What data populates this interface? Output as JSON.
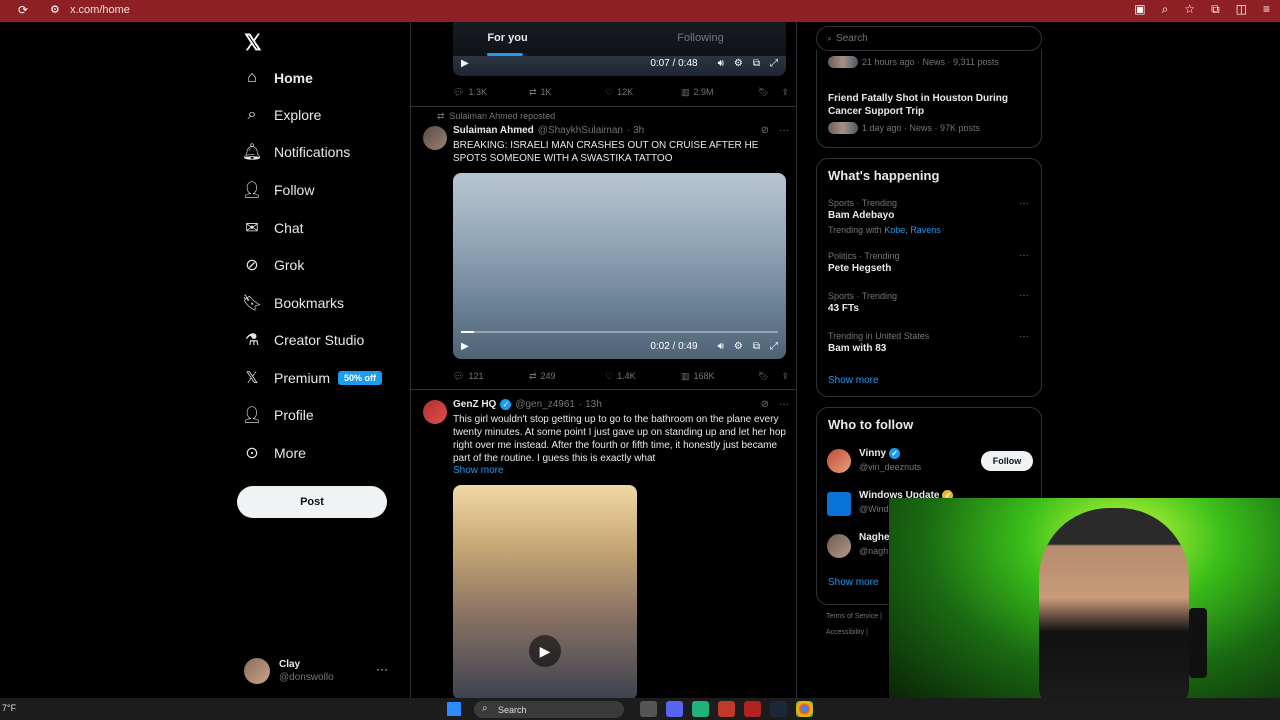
{
  "browser": {
    "url": "x.com/home"
  },
  "nav": {
    "logo": "𝕏",
    "items": [
      {
        "label": "Home",
        "icon": "home-icon"
      },
      {
        "label": "Explore",
        "icon": "search-icon"
      },
      {
        "label": "Notifications",
        "icon": "bell-icon"
      },
      {
        "label": "Follow",
        "icon": "person-plus-icon"
      },
      {
        "label": "Chat",
        "icon": "mail-icon"
      },
      {
        "label": "Grok",
        "icon": "grok-icon"
      },
      {
        "label": "Bookmarks",
        "icon": "bookmark-icon"
      },
      {
        "label": "Creator Studio",
        "icon": "flask-icon"
      },
      {
        "label": "Premium",
        "icon": "x-icon"
      },
      {
        "label": "Profile",
        "icon": "person-icon"
      },
      {
        "label": "More",
        "icon": "more-circle-icon"
      }
    ],
    "premium_badge": "50% off",
    "post_button": "Post",
    "account": {
      "name": "Clay",
      "handle": "@donswollo"
    }
  },
  "feed": {
    "tabs": [
      "For you",
      "Following"
    ],
    "top_video": {
      "time": "0:07 / 0:48"
    },
    "top_actions": {
      "replies": "1.3K",
      "reposts": "1K",
      "likes": "12K",
      "views": "2.9M"
    },
    "tweet1": {
      "repost_by": "Sulaiman Ahmed reposted",
      "name": "Sulaiman Ahmed",
      "handle": "@ShaykhSulaiman",
      "time": "· 3h",
      "text": "BREAKING: ISRAELI MAN CRASHES OUT ON CRUISE AFTER HE SPOTS SOMEONE WITH A SWASTIKA TATTOO",
      "video_time": "0:02 / 0:49",
      "progress": 0.04,
      "actions": {
        "replies": "121",
        "reposts": "249",
        "likes": "1.4K",
        "views": "168K"
      }
    },
    "tweet2": {
      "name": "GenZ HQ",
      "handle": "@gen_z4961",
      "time": "· 13h",
      "text": "This girl wouldn't stop getting up to go to the bathroom on the plane every twenty minutes. At some point I just gave up on standing up and let her hop right over me instead. After the fourth or fifth time, it honestly just became part of the routine. I guess this is exactly what",
      "show_more": "Show more"
    }
  },
  "right": {
    "search_placeholder": "Search",
    "news": [
      {
        "meta": "21 hours ago · News · 9,311 posts"
      },
      {
        "title": "Friend Fatally Shot in Houston During Cancer Support Trip",
        "meta": "1 day ago · News · 97K posts"
      }
    ],
    "happening": {
      "title": "What's happening",
      "trends": [
        {
          "context": "Sports · Trending",
          "name": "Bam Adebayo",
          "with_label": "Trending with",
          "with_links": "Kobe, Ravens"
        },
        {
          "context": "Politics · Trending",
          "name": "Pete Hegseth"
        },
        {
          "context": "Sports · Trending",
          "name": "43 FTs"
        },
        {
          "context": "Trending in United States",
          "name": "Bam with 83"
        }
      ],
      "show_more": "Show more"
    },
    "who_to_follow": {
      "title": "Who to follow",
      "accounts": [
        {
          "name": "Vinny",
          "handle": "@vin_deeznuts"
        },
        {
          "name": "Windows Update",
          "handle": "@Wind"
        },
        {
          "name": "Naghel",
          "handle": "@nagh"
        }
      ],
      "follow_label": "Follow",
      "show_more": "Show more"
    },
    "footer": {
      "line1": "Terms of Service |",
      "line2": "Accessibility |"
    }
  },
  "taskbar": {
    "left_text": "7°F",
    "search_label": "Search"
  },
  "colors": {
    "accent": "#1d9bf0",
    "browser_bar": "#8e1f24",
    "background": "#000000",
    "border": "#2f3336"
  }
}
